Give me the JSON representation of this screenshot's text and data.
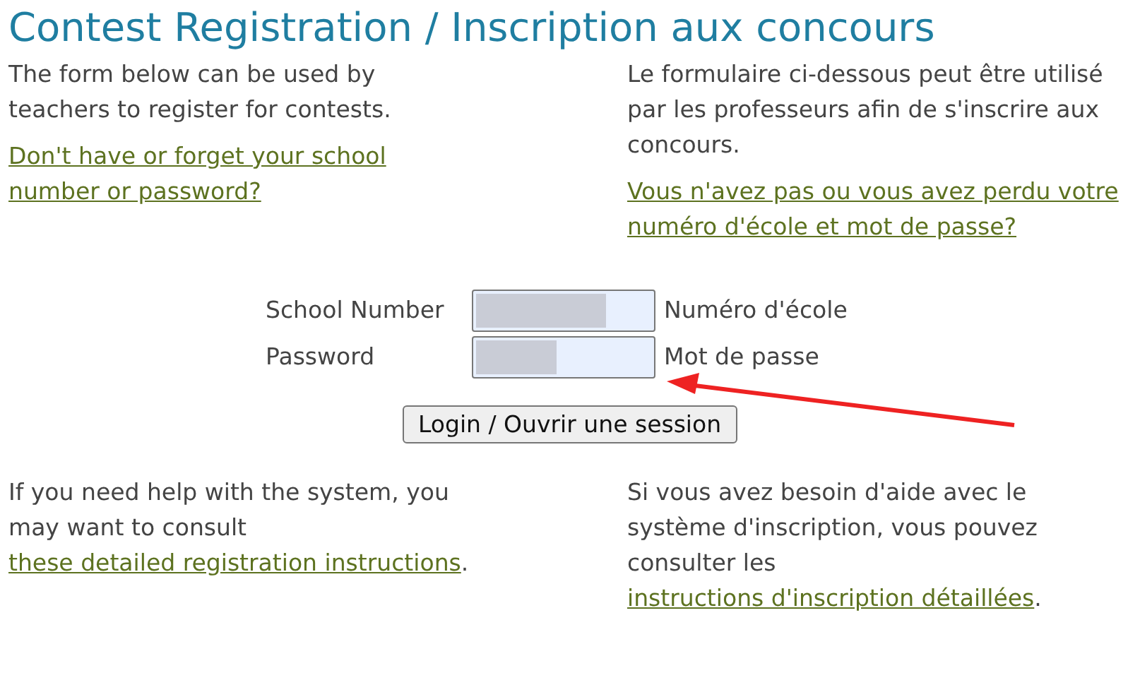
{
  "title": "Contest Registration / Inscription aux concours",
  "intro": {
    "en": "The form below can be used by teachers to register for contests.",
    "fr": "Le formulaire ci-dessous peut être utilisé par les professeurs afin de s'inscrire aux concours."
  },
  "recovery_links": {
    "en": "Don't have or forget your school number or password?",
    "fr": "Vous n'avez pas ou vous avez perdu votre numéro d'école et mot de passe?"
  },
  "form": {
    "fields": [
      {
        "label_en": "School Number",
        "label_fr": "Numéro d'école",
        "kind": "text"
      },
      {
        "label_en": "Password",
        "label_fr": "Mot de passe",
        "kind": "password"
      }
    ],
    "button": "Login / Ouvrir une session"
  },
  "help": {
    "en": {
      "before": "If you need help with the system, you may want to consult ",
      "link": "these detailed registration instructions",
      "after": "."
    },
    "fr": {
      "before": "Si vous avez besoin d'aide avec le système d'inscription, vous pouvez consulter les ",
      "link": "instructions d'inscription détaillées",
      "after": "."
    }
  }
}
